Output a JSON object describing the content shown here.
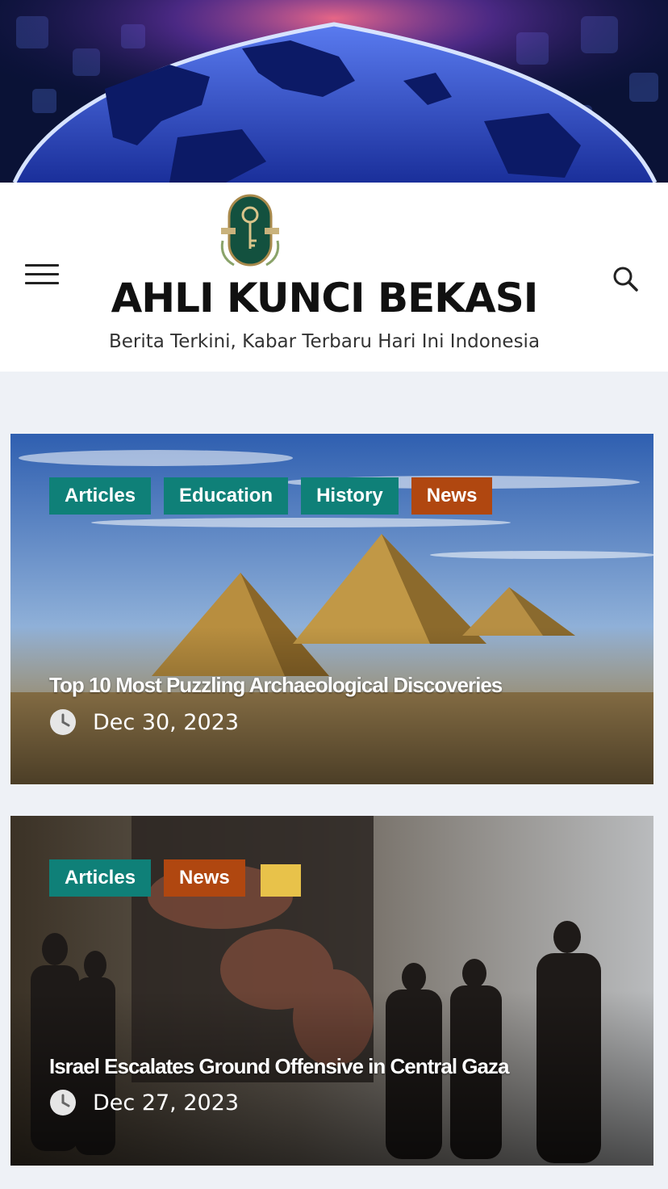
{
  "site": {
    "title": "AHLI KUNCI BEKASI",
    "tagline": "Berita Terkini, Kabar Terbaru Hari Ini Indonesia"
  },
  "header": {
    "menu_icon": "hamburger-menu-icon",
    "search_icon": "search-icon"
  },
  "posts": [
    {
      "categories": [
        {
          "label": "Articles",
          "color": "#0f8078"
        },
        {
          "label": "Education",
          "color": "#0f8078"
        },
        {
          "label": "History",
          "color": "#0f8078"
        },
        {
          "label": "News",
          "color": "#b04710"
        }
      ],
      "title": "Top 10 Most Puzzling Archaeological Discoveries",
      "date": "Dec 30, 2023",
      "date_icon": "clock-icon"
    },
    {
      "categories": [
        {
          "label": "Articles",
          "color": "#0f8078"
        },
        {
          "label": "News",
          "color": "#b04710"
        }
      ],
      "title": "Israel Escalates Ground Offensive in Central Gaza",
      "date": "Dec 27, 2023",
      "date_icon": "clock-icon"
    }
  ]
}
